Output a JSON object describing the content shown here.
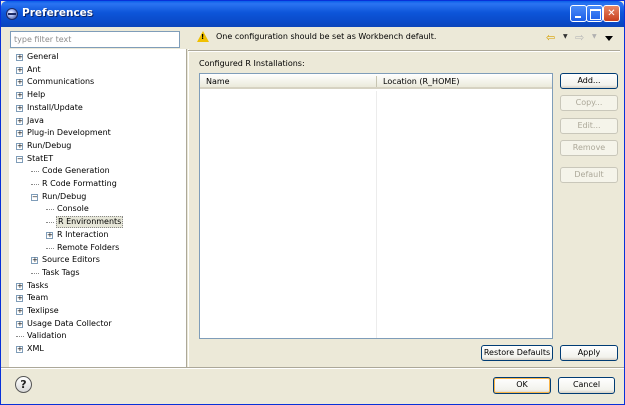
{
  "window": {
    "title": "Preferences"
  },
  "filter": {
    "placeholder": "type filter text"
  },
  "tree": [
    {
      "label": "General",
      "level": 0,
      "expander": "+"
    },
    {
      "label": "Ant",
      "level": 0,
      "expander": "+"
    },
    {
      "label": "Communications",
      "level": 0,
      "expander": "+"
    },
    {
      "label": "Help",
      "level": 0,
      "expander": "+"
    },
    {
      "label": "Install/Update",
      "level": 0,
      "expander": "+"
    },
    {
      "label": "Java",
      "level": 0,
      "expander": "+"
    },
    {
      "label": "Plug-in Development",
      "level": 0,
      "expander": "+"
    },
    {
      "label": "Run/Debug",
      "level": 0,
      "expander": "+"
    },
    {
      "label": "StatET",
      "level": 0,
      "expander": "-"
    },
    {
      "label": "Code Generation",
      "level": 1,
      "expander": ""
    },
    {
      "label": "R Code Formatting",
      "level": 1,
      "expander": ""
    },
    {
      "label": "Run/Debug",
      "level": 1,
      "expander": "-"
    },
    {
      "label": "Console",
      "level": 2,
      "expander": ""
    },
    {
      "label": "R Environments",
      "level": 2,
      "expander": "",
      "selected": true
    },
    {
      "label": "R Interaction",
      "level": 2,
      "expander": "+"
    },
    {
      "label": "Remote Folders",
      "level": 2,
      "expander": ""
    },
    {
      "label": "Source Editors",
      "level": 1,
      "expander": "+"
    },
    {
      "label": "Task Tags",
      "level": 1,
      "expander": ""
    },
    {
      "label": "Tasks",
      "level": 0,
      "expander": "+"
    },
    {
      "label": "Team",
      "level": 0,
      "expander": "+"
    },
    {
      "label": "Texlipse",
      "level": 0,
      "expander": "+"
    },
    {
      "label": "Usage Data Collector",
      "level": 0,
      "expander": "+"
    },
    {
      "label": "Validation",
      "level": 0,
      "expander": ""
    },
    {
      "label": "XML",
      "level": 0,
      "expander": "+"
    }
  ],
  "message": {
    "text": "One configuration should be set as Workbench default."
  },
  "page": {
    "section_label": "Configured R Installations:",
    "table": {
      "columns": [
        "Name",
        "Location (R_HOME)"
      ],
      "rows": []
    }
  },
  "buttons": {
    "add": "Add...",
    "copy": "Copy...",
    "edit": "Edit...",
    "remove": "Remove",
    "default": "Default",
    "restore_defaults": "Restore Defaults",
    "apply": "Apply",
    "ok": "OK",
    "cancel": "Cancel"
  },
  "icons": {
    "app": "eclipse-icon",
    "warning": "warning-icon",
    "back": "back-arrow-icon",
    "forward": "forward-arrow-icon",
    "help": "help-icon"
  },
  "colors": {
    "titlebar": "#0a4ac9",
    "selection": "#e6e6d8",
    "window_bg": "#ece9d8"
  }
}
